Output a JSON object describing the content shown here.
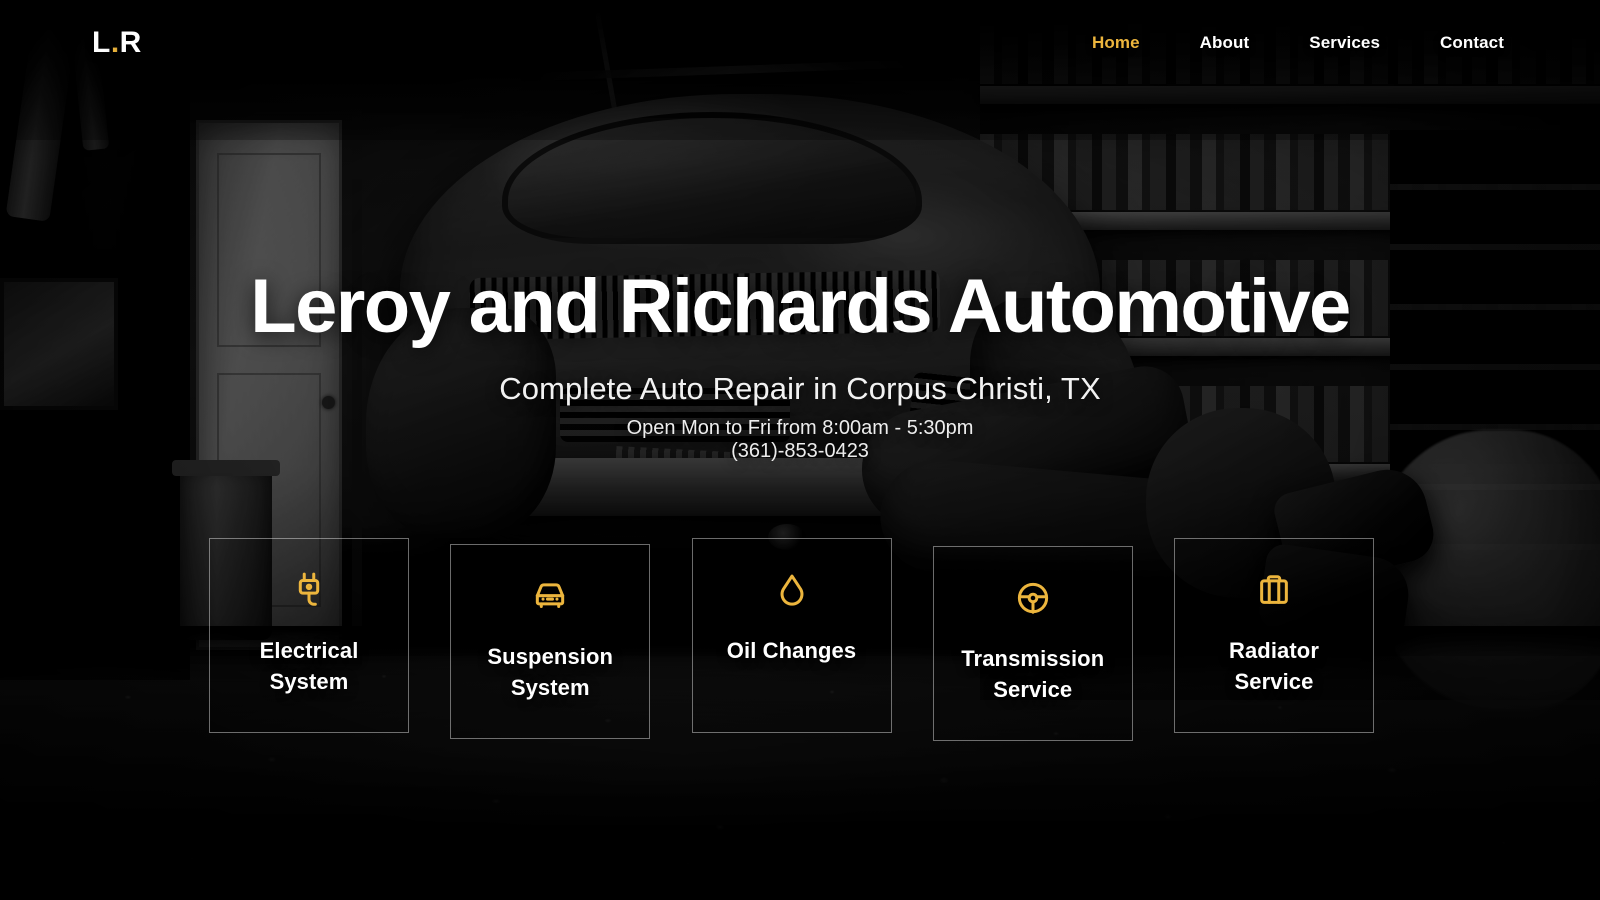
{
  "site": {
    "logo_text": "L",
    "logo_dot": ".",
    "logo_text2": "R",
    "accent_color": "#ecb53d",
    "text_color": "#ffffff",
    "background_theme": "dark-grayscale-garage-photo"
  },
  "nav": {
    "items": [
      {
        "label": "Home",
        "active": true
      },
      {
        "label": "About",
        "active": false
      },
      {
        "label": "Services",
        "active": false
      },
      {
        "label": "Contact",
        "active": false
      }
    ]
  },
  "hero": {
    "title": "Leroy and Richards Automotive",
    "subtitle": "Complete Auto Repair in Corpus Christi, TX",
    "hours": "Open Mon to Fri from 8:00am - 5:30pm",
    "phone": "(361)-853-0423"
  },
  "services": {
    "cards": [
      {
        "label": "Electrical\nSystem",
        "icon": "plug-icon"
      },
      {
        "label": "Suspension\nSystem",
        "icon": "car-front-icon"
      },
      {
        "label": "Oil Changes",
        "icon": "oil-drop-icon"
      },
      {
        "label": "Transmission\nService",
        "icon": "steering-wheel-icon"
      },
      {
        "label": "Radiator\nService",
        "icon": "radiator-icon"
      }
    ]
  }
}
